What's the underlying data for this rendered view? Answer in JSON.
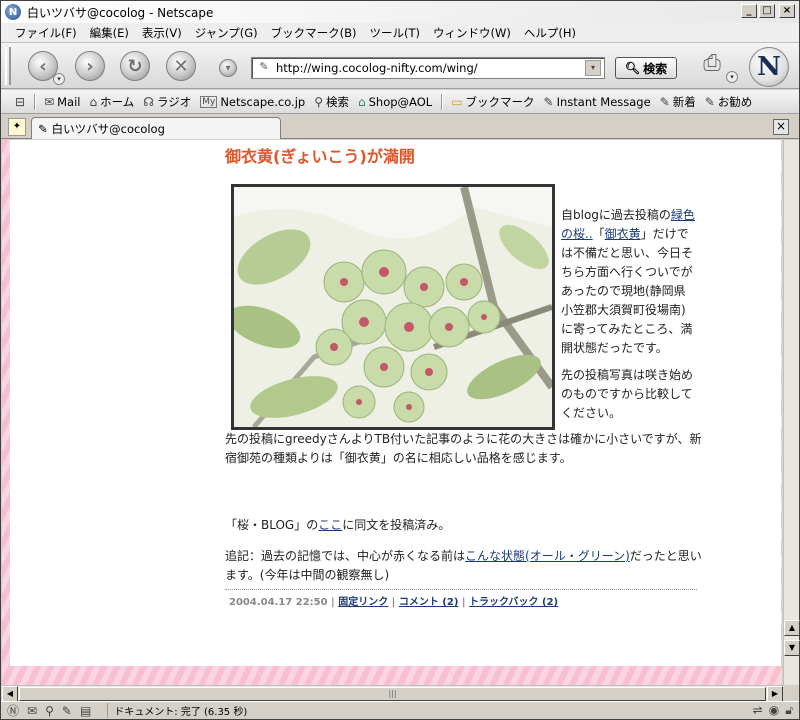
{
  "window": {
    "title": "白いツバサ@cocolog - Netscape",
    "app_icon": "netscape-logo-icon"
  },
  "menu": [
    "ファイル(F)",
    "編集(E)",
    "表示(V)",
    "ジャンプ(G)",
    "ブックマーク(B)",
    "ツール(T)",
    "ウィンドウ(W)",
    "ヘルプ(H)"
  ],
  "nav": {
    "url": "http://wing.cocolog-nifty.com/wing/",
    "search_label": "検索",
    "throbber_letter": "N"
  },
  "personal_toolbar": [
    {
      "label": "Mail",
      "icon": "mail-icon"
    },
    {
      "label": "ホーム",
      "icon": "home-icon"
    },
    {
      "label": "ラジオ",
      "icon": "radio-icon"
    },
    {
      "label": "Netscape.co.jp",
      "icon": "my-icon",
      "glyph": "My"
    },
    {
      "label": "検索",
      "icon": "search-icon"
    },
    {
      "label": "Shop@AOL",
      "icon": "shop-icon"
    },
    {
      "label": "ブックマーク",
      "icon": "bookmark-folder-icon"
    },
    {
      "label": "Instant Message",
      "icon": "instant-message-icon"
    },
    {
      "label": "新着",
      "icon": "new-icon"
    },
    {
      "label": "お勧め",
      "icon": "recommend-icon"
    }
  ],
  "tab": {
    "label": "白いツバサ@cocolog"
  },
  "post": {
    "title": "御衣黄(ぎょいこう)が満開",
    "side_p1_a": "自blogに過去投稿の",
    "side_link1": "緑色の桜..",
    "side_p1_b": "「",
    "side_link2": "御衣黄",
    "side_p1_c": "」だけでは不備だと思い、今日そちら方面へ行くついでがあったので現地(静岡県小笠郡大須賀町役場南)に寄ってみたところ、満開状態だったです。",
    "side_p2": "先の投稿写真は咲き始めのものですから比較してください。",
    "body_p1": "先の投稿にgreedyさんよりTB付いた記事のように花の大きさは確かに小さいですが、新宿御苑の種類よりは「御衣黄」の名に相応しい品格を感じます。",
    "body_p2_a": "「桜・BLOG」の",
    "body_p2_link": "ここ",
    "body_p2_b": "に同文を投稿済み。",
    "body_p3_a": "追記：過去の記憶では、中心が赤くなる前は",
    "body_p3_link": "こんな状態(オール・グリーン)",
    "body_p3_b": "だったと思います。(今年は中間の観察無し)",
    "footer_date": "2004.04.17 22:50",
    "footer_permalink": "固定リンク",
    "footer_comments": "コメント (2)",
    "footer_trackback": "トラックバック (2)"
  },
  "status": {
    "text": "ドキュメント: 完了 (6.35 秒)"
  }
}
